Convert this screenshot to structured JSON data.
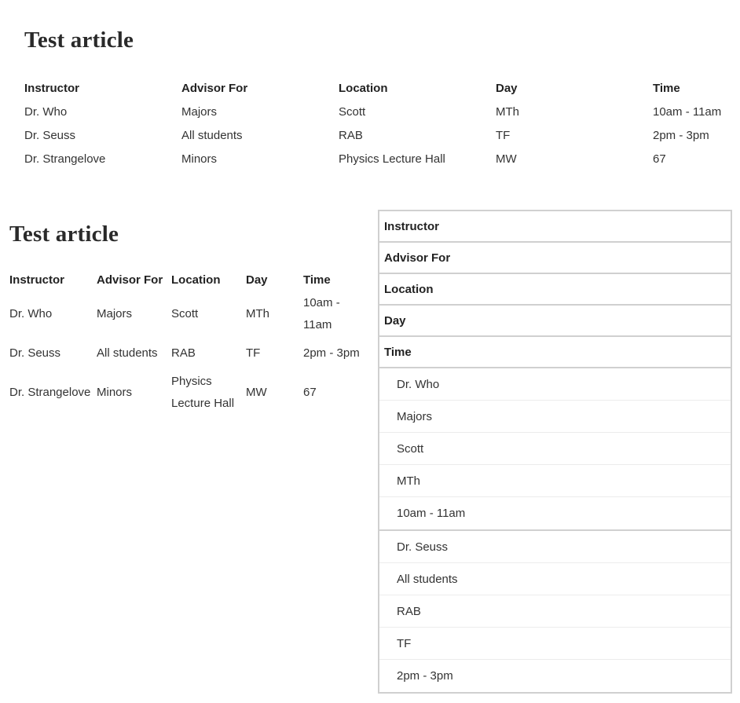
{
  "articles": [
    {
      "title": "Test article",
      "headers": [
        "Instructor",
        "Advisor For",
        "Location",
        "Day",
        "Time"
      ],
      "rows": [
        [
          "Dr. Who",
          "Majors",
          "Scott",
          "MTh",
          "10am - 11am"
        ],
        [
          "Dr. Seuss",
          "All students",
          "RAB",
          "TF",
          "2pm - 3pm"
        ],
        [
          "Dr. Strangelove",
          "Minors",
          "Physics Lecture Hall",
          "MW",
          "67"
        ]
      ]
    },
    {
      "title": "Test article",
      "headers": [
        "Instructor",
        "Advisor For",
        "Location",
        "Day",
        "Time"
      ],
      "rows": [
        [
          "Dr. Who",
          "Majors",
          "Scott",
          "MTh",
          "10am - 11am"
        ],
        [
          "Dr. Seuss",
          "All students",
          "RAB",
          "TF",
          "2pm - 3pm"
        ],
        [
          "Dr. Strangelove",
          "Minors",
          "Physics Lecture Hall",
          "MW",
          "67"
        ]
      ]
    }
  ],
  "stacked": {
    "headers": [
      "Instructor",
      "Advisor For",
      "Location",
      "Day",
      "Time"
    ],
    "groups": [
      [
        "Dr. Who",
        "Majors",
        "Scott",
        "MTh",
        "10am - 11am"
      ],
      [
        "Dr. Seuss",
        "All students",
        "RAB",
        "TF",
        "2pm - 3pm"
      ]
    ]
  }
}
